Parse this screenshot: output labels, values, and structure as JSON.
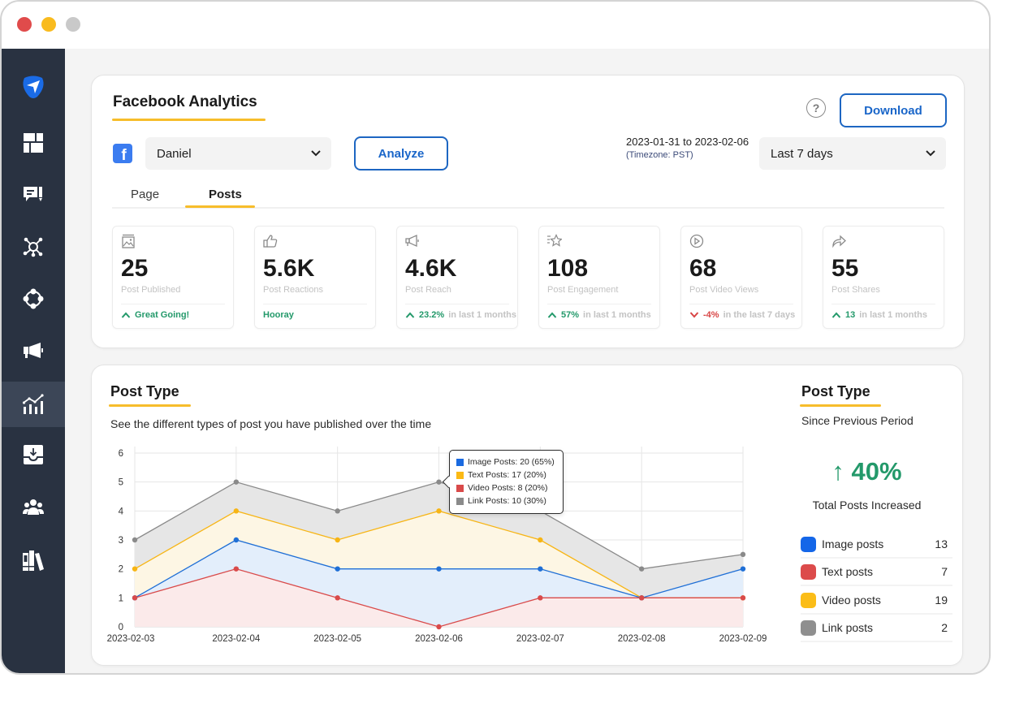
{
  "window": {
    "controls": [
      "close",
      "minimize",
      "maximize"
    ]
  },
  "sidebar": {
    "items": [
      {
        "id": "logo",
        "icon": "paper-plane-logo-icon"
      },
      {
        "id": "dashboard",
        "icon": "dashboard-grid-icon"
      },
      {
        "id": "compose",
        "icon": "compose-message-icon"
      },
      {
        "id": "network",
        "icon": "network-hub-icon"
      },
      {
        "id": "connections",
        "icon": "connected-nodes-icon"
      },
      {
        "id": "campaigns",
        "icon": "megaphone-icon"
      },
      {
        "id": "analytics",
        "icon": "analytics-chart-icon",
        "active": true
      },
      {
        "id": "inbox",
        "icon": "inbox-download-icon"
      },
      {
        "id": "team",
        "icon": "team-icon"
      },
      {
        "id": "library",
        "icon": "library-books-icon"
      }
    ]
  },
  "header": {
    "title": "Facebook Analytics",
    "help_icon": "question-icon",
    "download_label": "Download"
  },
  "filters": {
    "account_icon": "facebook-icon",
    "account_glyph": "f",
    "account": "Daniel",
    "analyze_label": "Analyze",
    "date_range": "2023-01-31 to 2023-02-06",
    "timezone": "(Timezone: PST)",
    "period": "Last 7 days"
  },
  "tabs": [
    {
      "label": "Page",
      "active": false
    },
    {
      "label": "Posts",
      "active": true
    }
  ],
  "stats": [
    {
      "icon": "image-icon",
      "value": "25",
      "label": "Post Published",
      "trend": "up",
      "highlight": "Great Going!",
      "rest": ""
    },
    {
      "icon": "thumbs-up-icon",
      "value": "5.6K",
      "label": "Post Reactions",
      "trend": "none",
      "highlight": "Hooray",
      "rest": ""
    },
    {
      "icon": "megaphone-icon",
      "value": "4.6K",
      "label": "Post Reach",
      "trend": "up",
      "highlight": "23.2%",
      "rest": "in last 1 months"
    },
    {
      "icon": "star-icon",
      "value": "108",
      "label": "Post Engagement",
      "trend": "up",
      "highlight": "57%",
      "rest": "in last 1 months"
    },
    {
      "icon": "play-icon",
      "value": "68",
      "label": "Post Video Views",
      "trend": "down",
      "highlight": "-4%",
      "rest": "in the last 7 days"
    },
    {
      "icon": "share-icon",
      "value": "55",
      "label": "Post Shares",
      "trend": "up",
      "highlight": "13",
      "rest": "in last 1 months"
    }
  ],
  "post_type": {
    "title": "Post Type",
    "subtitle": "See the different types of post you have published over the time",
    "tooltip": {
      "items": [
        {
          "text": "Image Posts: 20 (65%)",
          "color": "#1a6ae0"
        },
        {
          "text": "Text Posts: 17 (20%)",
          "color": "#fbb914"
        },
        {
          "text": "Video Posts: 8 (20%)",
          "color": "#d94a4a"
        },
        {
          "text": "Link Posts: 10 (30%)",
          "color": "#8a8a8a"
        }
      ]
    }
  },
  "summary": {
    "title": "Post Type",
    "subtitle": "Since Previous Period",
    "change_arrow": "↑",
    "change": "40%",
    "change_label": "Total Posts Increased",
    "items": [
      {
        "label": "Image posts",
        "value": "13",
        "color": "#1466e8"
      },
      {
        "label": "Text posts",
        "value": "7",
        "color": "#dc4b4b"
      },
      {
        "label": "Video posts",
        "value": "19",
        "color": "#fbbd18"
      },
      {
        "label": "Link posts",
        "value": "2",
        "color": "#8f8f8f"
      }
    ]
  },
  "colors": {
    "accent": "#1d66c2",
    "underline": "#f7bd2b",
    "positive": "#23996a",
    "negative": "#d84545",
    "sidebar": "#293241"
  },
  "chart_data": {
    "type": "area",
    "title": "Post Type",
    "xlabel": "",
    "ylabel": "",
    "x": [
      "2023-02-03",
      "2023-02-04",
      "2023-02-05",
      "2023-02-06",
      "2023-02-07",
      "2023-02-08",
      "2023-02-09"
    ],
    "ylim": [
      0,
      6
    ],
    "yticks": [
      0,
      1,
      2,
      3,
      4,
      5,
      6
    ],
    "grid": true,
    "legend": "tooltip",
    "series": [
      {
        "name": "Link Posts",
        "color": "#8a8a8a",
        "fill": "#e6e6e6",
        "values": [
          3,
          5,
          4,
          5,
          4,
          2,
          2.5
        ]
      },
      {
        "name": "Text Posts",
        "color": "#f7b515",
        "fill": "#fdf6e4",
        "values": [
          2,
          4,
          3,
          4,
          3,
          1,
          1
        ]
      },
      {
        "name": "Image Posts",
        "color": "#1f6fd6",
        "fill": "#e3eefb",
        "values": [
          1,
          3,
          2,
          2,
          2,
          1,
          2
        ]
      },
      {
        "name": "Video Posts",
        "color": "#d94a4a",
        "fill": "#fbeaea",
        "values": [
          1,
          2,
          1,
          0,
          1,
          1,
          1
        ]
      }
    ]
  }
}
